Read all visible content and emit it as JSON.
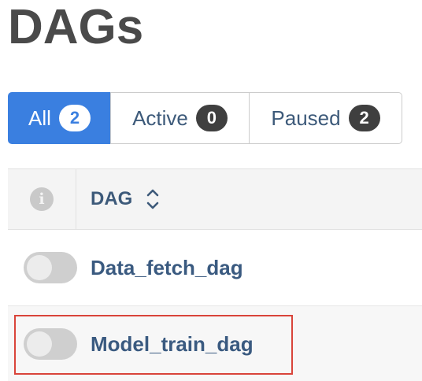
{
  "page": {
    "title": "DAGs"
  },
  "filters": [
    {
      "label": "All",
      "count": "2",
      "active": true
    },
    {
      "label": "Active",
      "count": "0",
      "active": false
    },
    {
      "label": "Paused",
      "count": "2",
      "active": false
    }
  ],
  "table": {
    "columns": {
      "info_icon": "info-icon",
      "dag": "DAG",
      "sort_icon": "sort-icon"
    },
    "rows": [
      {
        "dag_id": "Data_fetch_dag",
        "paused": true
      },
      {
        "dag_id": "Model_train_dag",
        "paused": true,
        "highlighted": true
      }
    ]
  },
  "colors": {
    "accent": "#3a7fe0",
    "link": "#3a5a80",
    "highlight_border": "#d9443a"
  }
}
